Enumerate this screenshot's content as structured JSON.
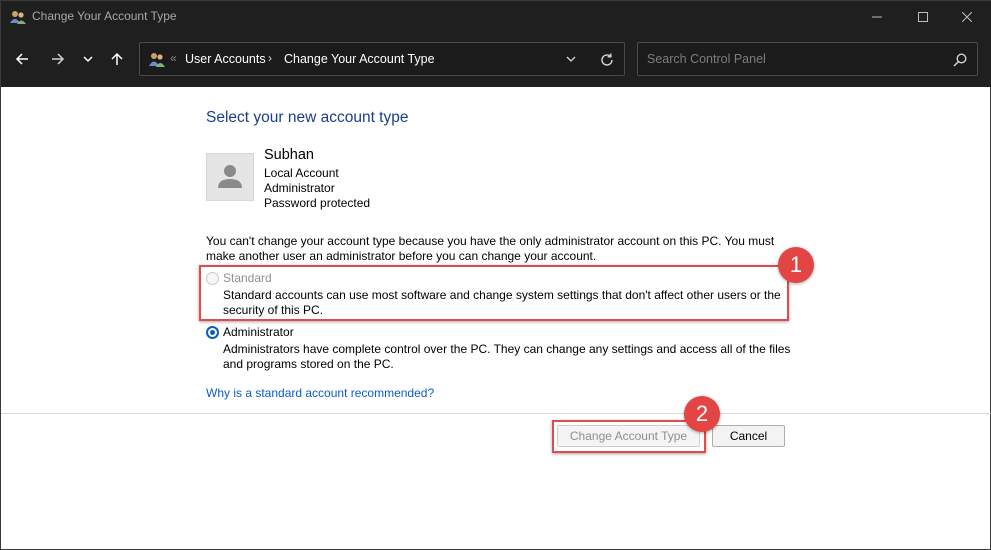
{
  "window": {
    "title": "Change Your Account Type"
  },
  "navigation": {
    "breadcrumbs": [
      "User Accounts",
      "Change Your Account Type"
    ],
    "overflow_chevron": "«",
    "crumb_separator": "›",
    "search_placeholder": "Search Control Panel"
  },
  "content": {
    "heading": "Select your new account type",
    "user": {
      "name": "Subhan",
      "lines": [
        "Local Account",
        "Administrator",
        "Password protected"
      ]
    },
    "notice": "You can't change your account type because you have the only administrator account on this PC. You must make another user an administrator before you can change your account.",
    "options": [
      {
        "label": "Standard",
        "description": "Standard accounts can use most software and change system settings that don't affect other users or the security of this PC.",
        "selected": false,
        "disabled": true
      },
      {
        "label": "Administrator",
        "description": "Administrators have complete control over the PC. They can change any settings and access all of the files and programs stored on the PC.",
        "selected": true,
        "disabled": false
      }
    ],
    "help_link": "Why is a standard account recommended?"
  },
  "buttons": {
    "change": "Change Account Type",
    "cancel": "Cancel"
  },
  "annotations": {
    "step1": "1",
    "step2": "2"
  },
  "colors": {
    "titlebar": "#1f1f1f",
    "heading": "#1a3e8a",
    "link": "#0b5dc6",
    "callout": "#e34545",
    "radio_selected": "#0a5fb8"
  },
  "icons": {
    "app": "user-accounts-icon",
    "back": "arrow-left-icon",
    "forward": "arrow-right-icon",
    "recent": "chevron-down-icon",
    "up": "arrow-up-icon",
    "refresh": "refresh-icon",
    "search": "search-icon",
    "minimize": "minimize-icon",
    "maximize": "maximize-icon",
    "close": "close-icon",
    "avatar": "user-avatar-icon"
  }
}
